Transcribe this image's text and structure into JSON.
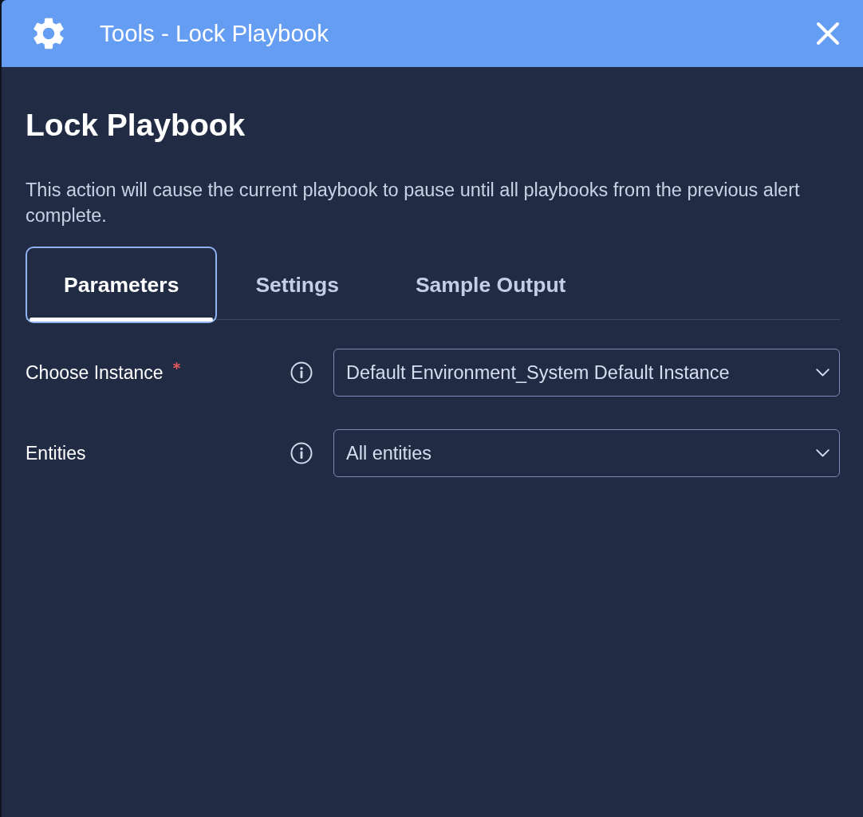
{
  "window": {
    "title": "Tools - Lock Playbook"
  },
  "heading": "Lock Playbook",
  "description": "This action will cause the current playbook to pause until all playbooks from the previous alert complete.",
  "tabs": [
    {
      "label": "Parameters",
      "selected": true
    },
    {
      "label": "Settings",
      "selected": false
    },
    {
      "label": "Sample Output",
      "selected": false
    }
  ],
  "fields": [
    {
      "label": "Choose Instance",
      "required": true,
      "value": "Default Environment_System Default Instance"
    },
    {
      "label": "Entities",
      "required": false,
      "value": "All entities"
    }
  ]
}
